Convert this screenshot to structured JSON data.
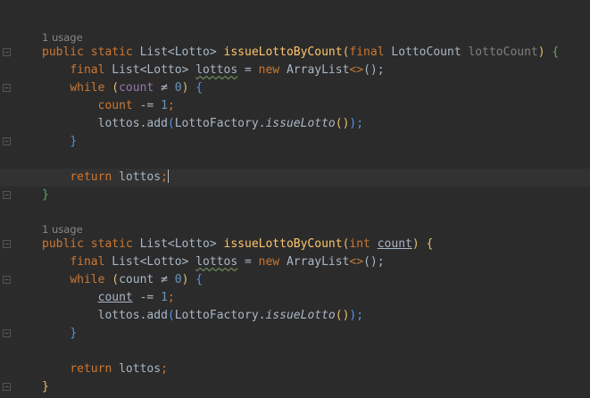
{
  "editor": {
    "usage_hint_1": "1 usage",
    "usage_hint_2": "1 usage",
    "method1": {
      "kw_public": "public",
      "kw_static": "static",
      "return_type": "List<Lotto>",
      "name": "issueLottoByCount",
      "paren_open": "(",
      "kw_final": "final",
      "param_type": "LottoCount",
      "param_name": "lottoCount",
      "paren_close": ")",
      "brace_open": "{",
      "line2_final": "final",
      "line2_type": "List<Lotto>",
      "line2_var": "lottos",
      "line2_eq": "=",
      "line2_new": "new",
      "line2_ctor": "ArrayList",
      "line2_diamond": "<>",
      "line2_end": "();",
      "while_kw": "while",
      "while_cond_open": "(",
      "while_var": "count",
      "while_op": "≠",
      "while_num": "0",
      "while_cond_close": ")",
      "while_brace": "{",
      "dec_var": "count",
      "dec_op": "-=",
      "dec_num": "1",
      "dec_end": ";",
      "add_obj": "lottos.add",
      "add_open": "(",
      "add_factory": "LottoFactory.",
      "add_method": "issueLotto",
      "add_call": "()",
      "add_close": ");",
      "while_end": "}",
      "return_kw": "return",
      "return_val": "lottos",
      "return_end": ";",
      "brace_close": "}"
    },
    "method2": {
      "kw_public": "public",
      "kw_static": "static",
      "return_type": "List<Lotto>",
      "name": "issueLottoByCount",
      "paren_open": "(",
      "param_type": "int",
      "param_name": "count",
      "paren_close": ")",
      "brace_open": "{",
      "line2_final": "final",
      "line2_type": "List<Lotto>",
      "line2_var": "lottos",
      "line2_eq": "=",
      "line2_new": "new",
      "line2_ctor": "ArrayList",
      "line2_diamond": "<>",
      "line2_end": "();",
      "while_kw": "while",
      "while_cond_open": "(",
      "while_var": "count",
      "while_op": "≠",
      "while_num": "0",
      "while_cond_close": ")",
      "while_brace": "{",
      "dec_var": "count",
      "dec_op": "-=",
      "dec_num": "1",
      "dec_end": ";",
      "add_obj": "lottos.add",
      "add_open": "(",
      "add_factory": "LottoFactory.",
      "add_method": "issueLotto",
      "add_call": "()",
      "add_close": ");",
      "while_end": "}",
      "return_kw": "return",
      "return_val": "lottos",
      "return_end": ";",
      "brace_close": "}"
    },
    "colors": {
      "background": "#2b2b2b",
      "keyword": "#cc7832",
      "method_name": "#ffc66d",
      "number": "#6897bb",
      "text": "#a9b7c6",
      "current_line": "#323232"
    },
    "icons": {
      "fold_marker": "fold-icon",
      "caret": "text-caret"
    }
  }
}
